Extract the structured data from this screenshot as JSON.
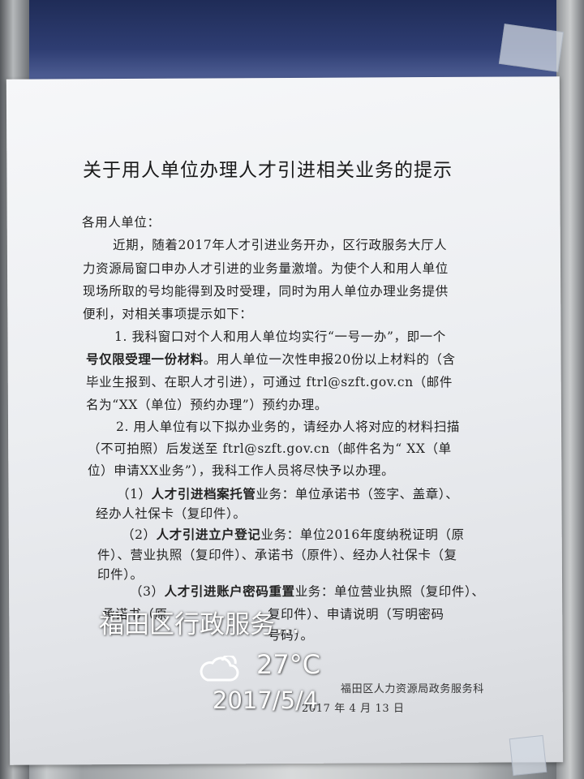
{
  "notice": {
    "title": "关于用人单位办理人才引进相关业务的提示",
    "greeting": "各用人单位：",
    "para1": [
      "近期，随着2017年人才引进业务开办，区行政服务大厅人",
      "力资源局窗口申办人才引进的业务量激增。为使个人和用人单位",
      "现场所取的号均能得到及时受理，同时为用人单位办理业务提供",
      "便利，对相关事项提示如下："
    ],
    "item1": [
      "1. 我科窗口对个人和用人单位均实行“一号一办”，即一个",
      "号仅限受理一份材料",
      "。用人单位一次性申报20份以上材料的（含",
      "毕业生报到、在职人才引进），可通过 ftrl@szft.gov.cn（邮件",
      "名为“XX（单位）预约办理”）预约办理。"
    ],
    "item2": [
      "2. 用人单位有以下拟办业务的，请经办人将对应的材料扫描",
      "（不可拍照）后发送至 ftrl@szft.gov.cn（邮件名为“ XX（单",
      "位）申请XX业务”），我科工作人员将尽快予以办理。"
    ],
    "sub1": [
      "（1）",
      "人才引进档案托管",
      "业务：单位承诺书（签字、盖章）、",
      "经办人社保卡（复印件）。"
    ],
    "sub2": [
      "（2）",
      "人才引进立户登记",
      "业务：单位2016年度纳税证明（原",
      "件）、营业执照（复印件）、承诺书（原件）、经办人社保卡（复",
      "印件）。"
    ],
    "sub3": [
      "（3）",
      "人才引进账户密码重置",
      "业务：单位营业执照（复印件）、",
      "承诺书（原",
      "复印件）、申请说明（写明密码",
      "号码）。"
    ],
    "signature": "福田区人力资源局政务服务科",
    "date": "2017 年 4 月 13 日"
  },
  "watermark": {
    "location": "福田区行政服务…",
    "weather_icon": "cloudy-icon",
    "temperature": "27°C",
    "date": "2017/5/4"
  }
}
